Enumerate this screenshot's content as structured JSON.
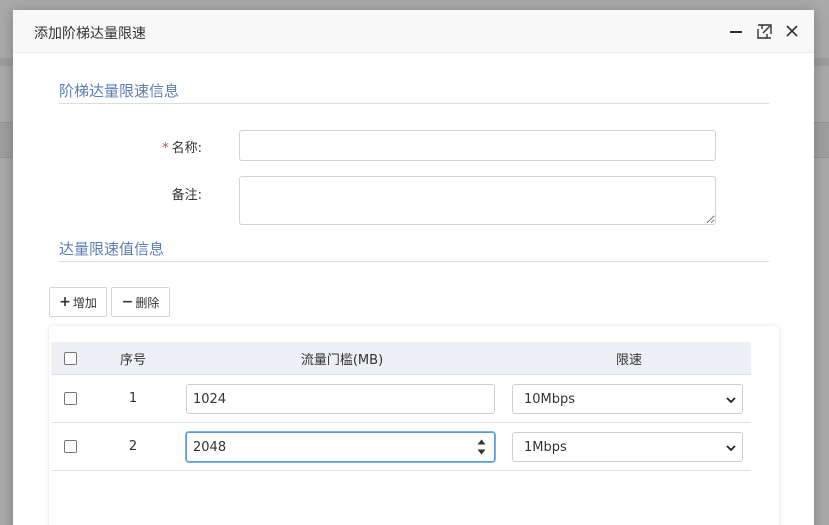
{
  "modal": {
    "title": "添加阶梯达量限速",
    "controls": {
      "minimize": "minimize-icon",
      "maximize": "maximize-icon",
      "close": "close-icon"
    }
  },
  "section1": {
    "title": "阶梯达量限速信息"
  },
  "form": {
    "name_label": "名称:",
    "name_required": "*",
    "name_value": "",
    "note_label": "备注:",
    "note_value": ""
  },
  "section2": {
    "title": "达量限速值信息"
  },
  "toolbar": {
    "add_label": "增加",
    "delete_label": "删除"
  },
  "grid": {
    "headers": {
      "seq": "序号",
      "threshold": "流量门槛(MB)",
      "limit": "限速"
    },
    "rows": [
      {
        "seq": "1",
        "threshold": "1024",
        "limit": "10Mbps",
        "checked": false
      },
      {
        "seq": "2",
        "threshold": "2048",
        "limit": "1Mbps",
        "checked": false
      }
    ]
  },
  "colors": {
    "section_title": "#5b7fb5",
    "required": "#e4393c",
    "focus": "#5b9bd5"
  }
}
